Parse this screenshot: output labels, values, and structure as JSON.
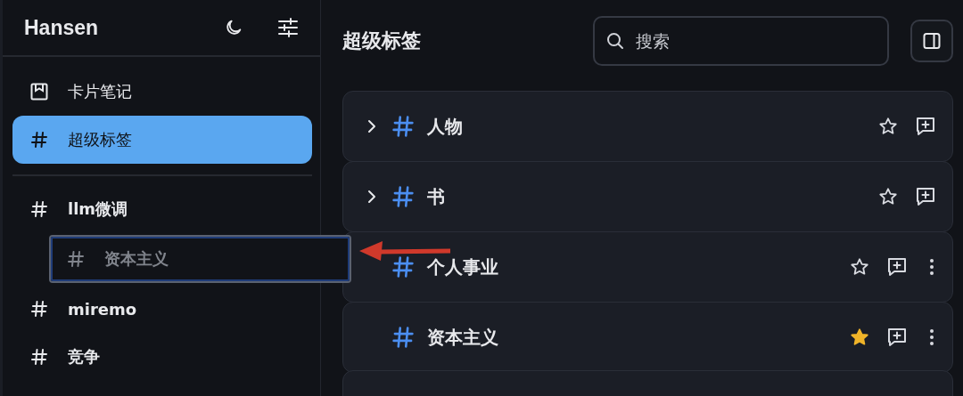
{
  "sidebar": {
    "title": "Hansen",
    "nav": [
      {
        "label": "卡片笔记",
        "kind": "card",
        "selected": false
      },
      {
        "label": "超级标签",
        "kind": "hash",
        "selected": true
      }
    ],
    "tags": [
      {
        "label": "llm微调",
        "kind": "tag"
      },
      {
        "label": "资本主义",
        "kind": "drag"
      },
      {
        "label": "miremo",
        "kind": "tag"
      },
      {
        "label": "竞争",
        "kind": "tag"
      }
    ]
  },
  "main": {
    "title": "超级标签",
    "search": {
      "placeholder": "搜索"
    },
    "tags": [
      {
        "label": "人物",
        "has_children": true,
        "starred": false,
        "menu": false
      },
      {
        "label": "书",
        "has_children": true,
        "starred": false,
        "menu": false
      },
      {
        "label": "个人事业",
        "has_children": false,
        "starred": false,
        "menu": true
      },
      {
        "label": "资本主义",
        "has_children": false,
        "starred": true,
        "menu": true
      }
    ]
  }
}
